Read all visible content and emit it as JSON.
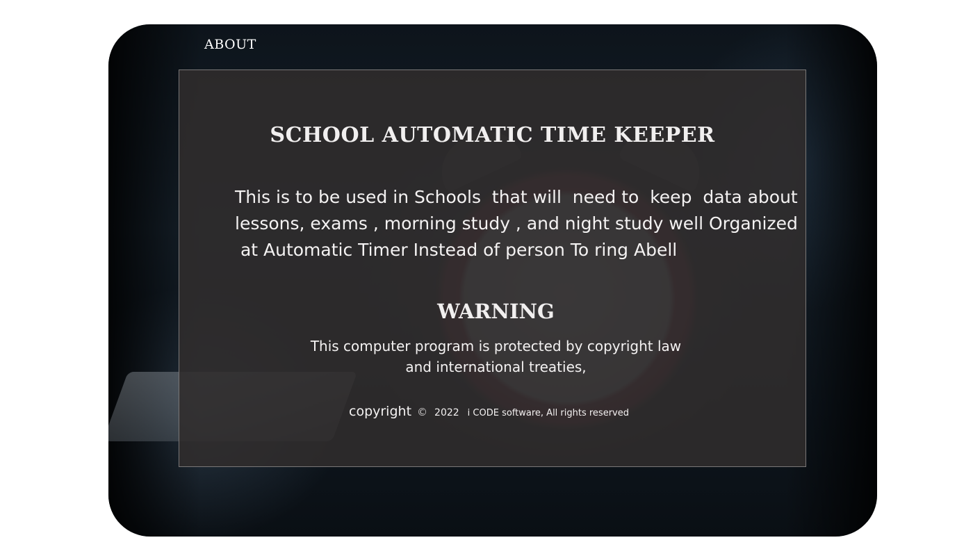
{
  "nav": {
    "about_label": "ABOUT"
  },
  "content": {
    "title": "SCHOOL AUTOMATIC TIME KEEPER",
    "description_lines": [
      "This is to be used in Schools  that will  need to  keep  data about",
      "lessons, exams , morning study , and night study well Organized",
      " at Automatic Timer Instead of person To ring Abell"
    ],
    "warning_title": "WARNING",
    "warning_lines": [
      "This computer program is protected by copyright law",
      "and international treaties,"
    ]
  },
  "footer": {
    "copyright_word": "copyright",
    "copyright_symbol": "©",
    "year": "2022",
    "owner": "i CODE software, All rights reserved"
  },
  "colors": {
    "panel_bg": "#302c2c",
    "text": "#f4f2f2",
    "page_bg": "#ffffff"
  }
}
